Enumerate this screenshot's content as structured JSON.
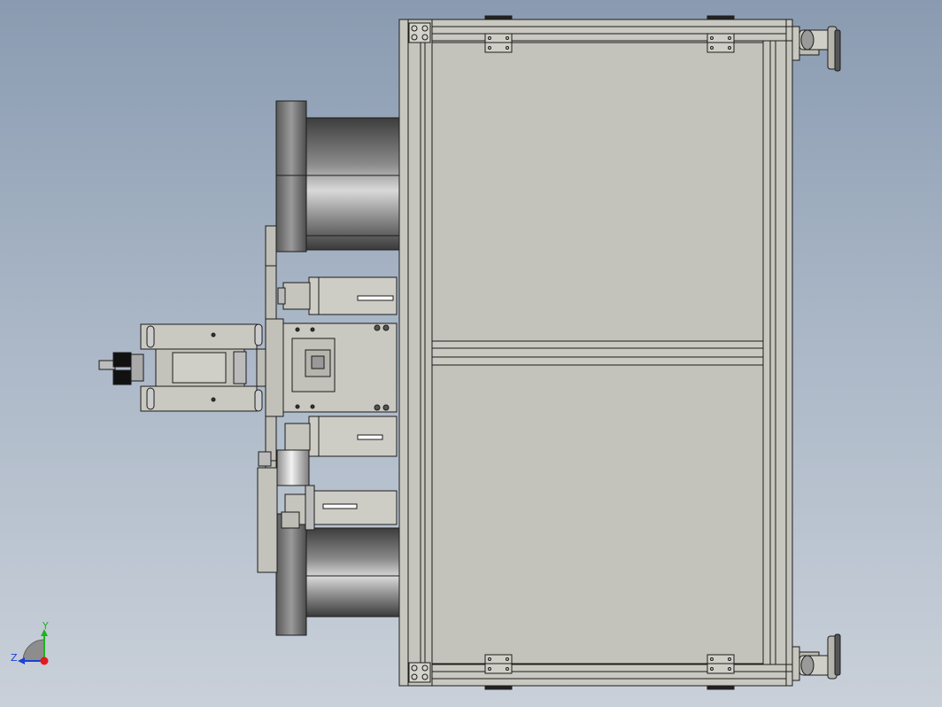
{
  "viewport": {
    "background_top": "#8a9bb1",
    "background_bottom": "#c9d0d9"
  },
  "model": {
    "frame_fill": "#c5c5bd",
    "panel_fill": "#c4c3bb",
    "line_color": "#1c1c1c",
    "drum_dark": "#4a4a4a",
    "drum_light": "#d8d8d8"
  },
  "triad": {
    "y_label": "Y",
    "z_label": "Z",
    "y_color": "#1db31d",
    "z_color": "#1d3fd6",
    "x_color": "#e01b1b"
  }
}
